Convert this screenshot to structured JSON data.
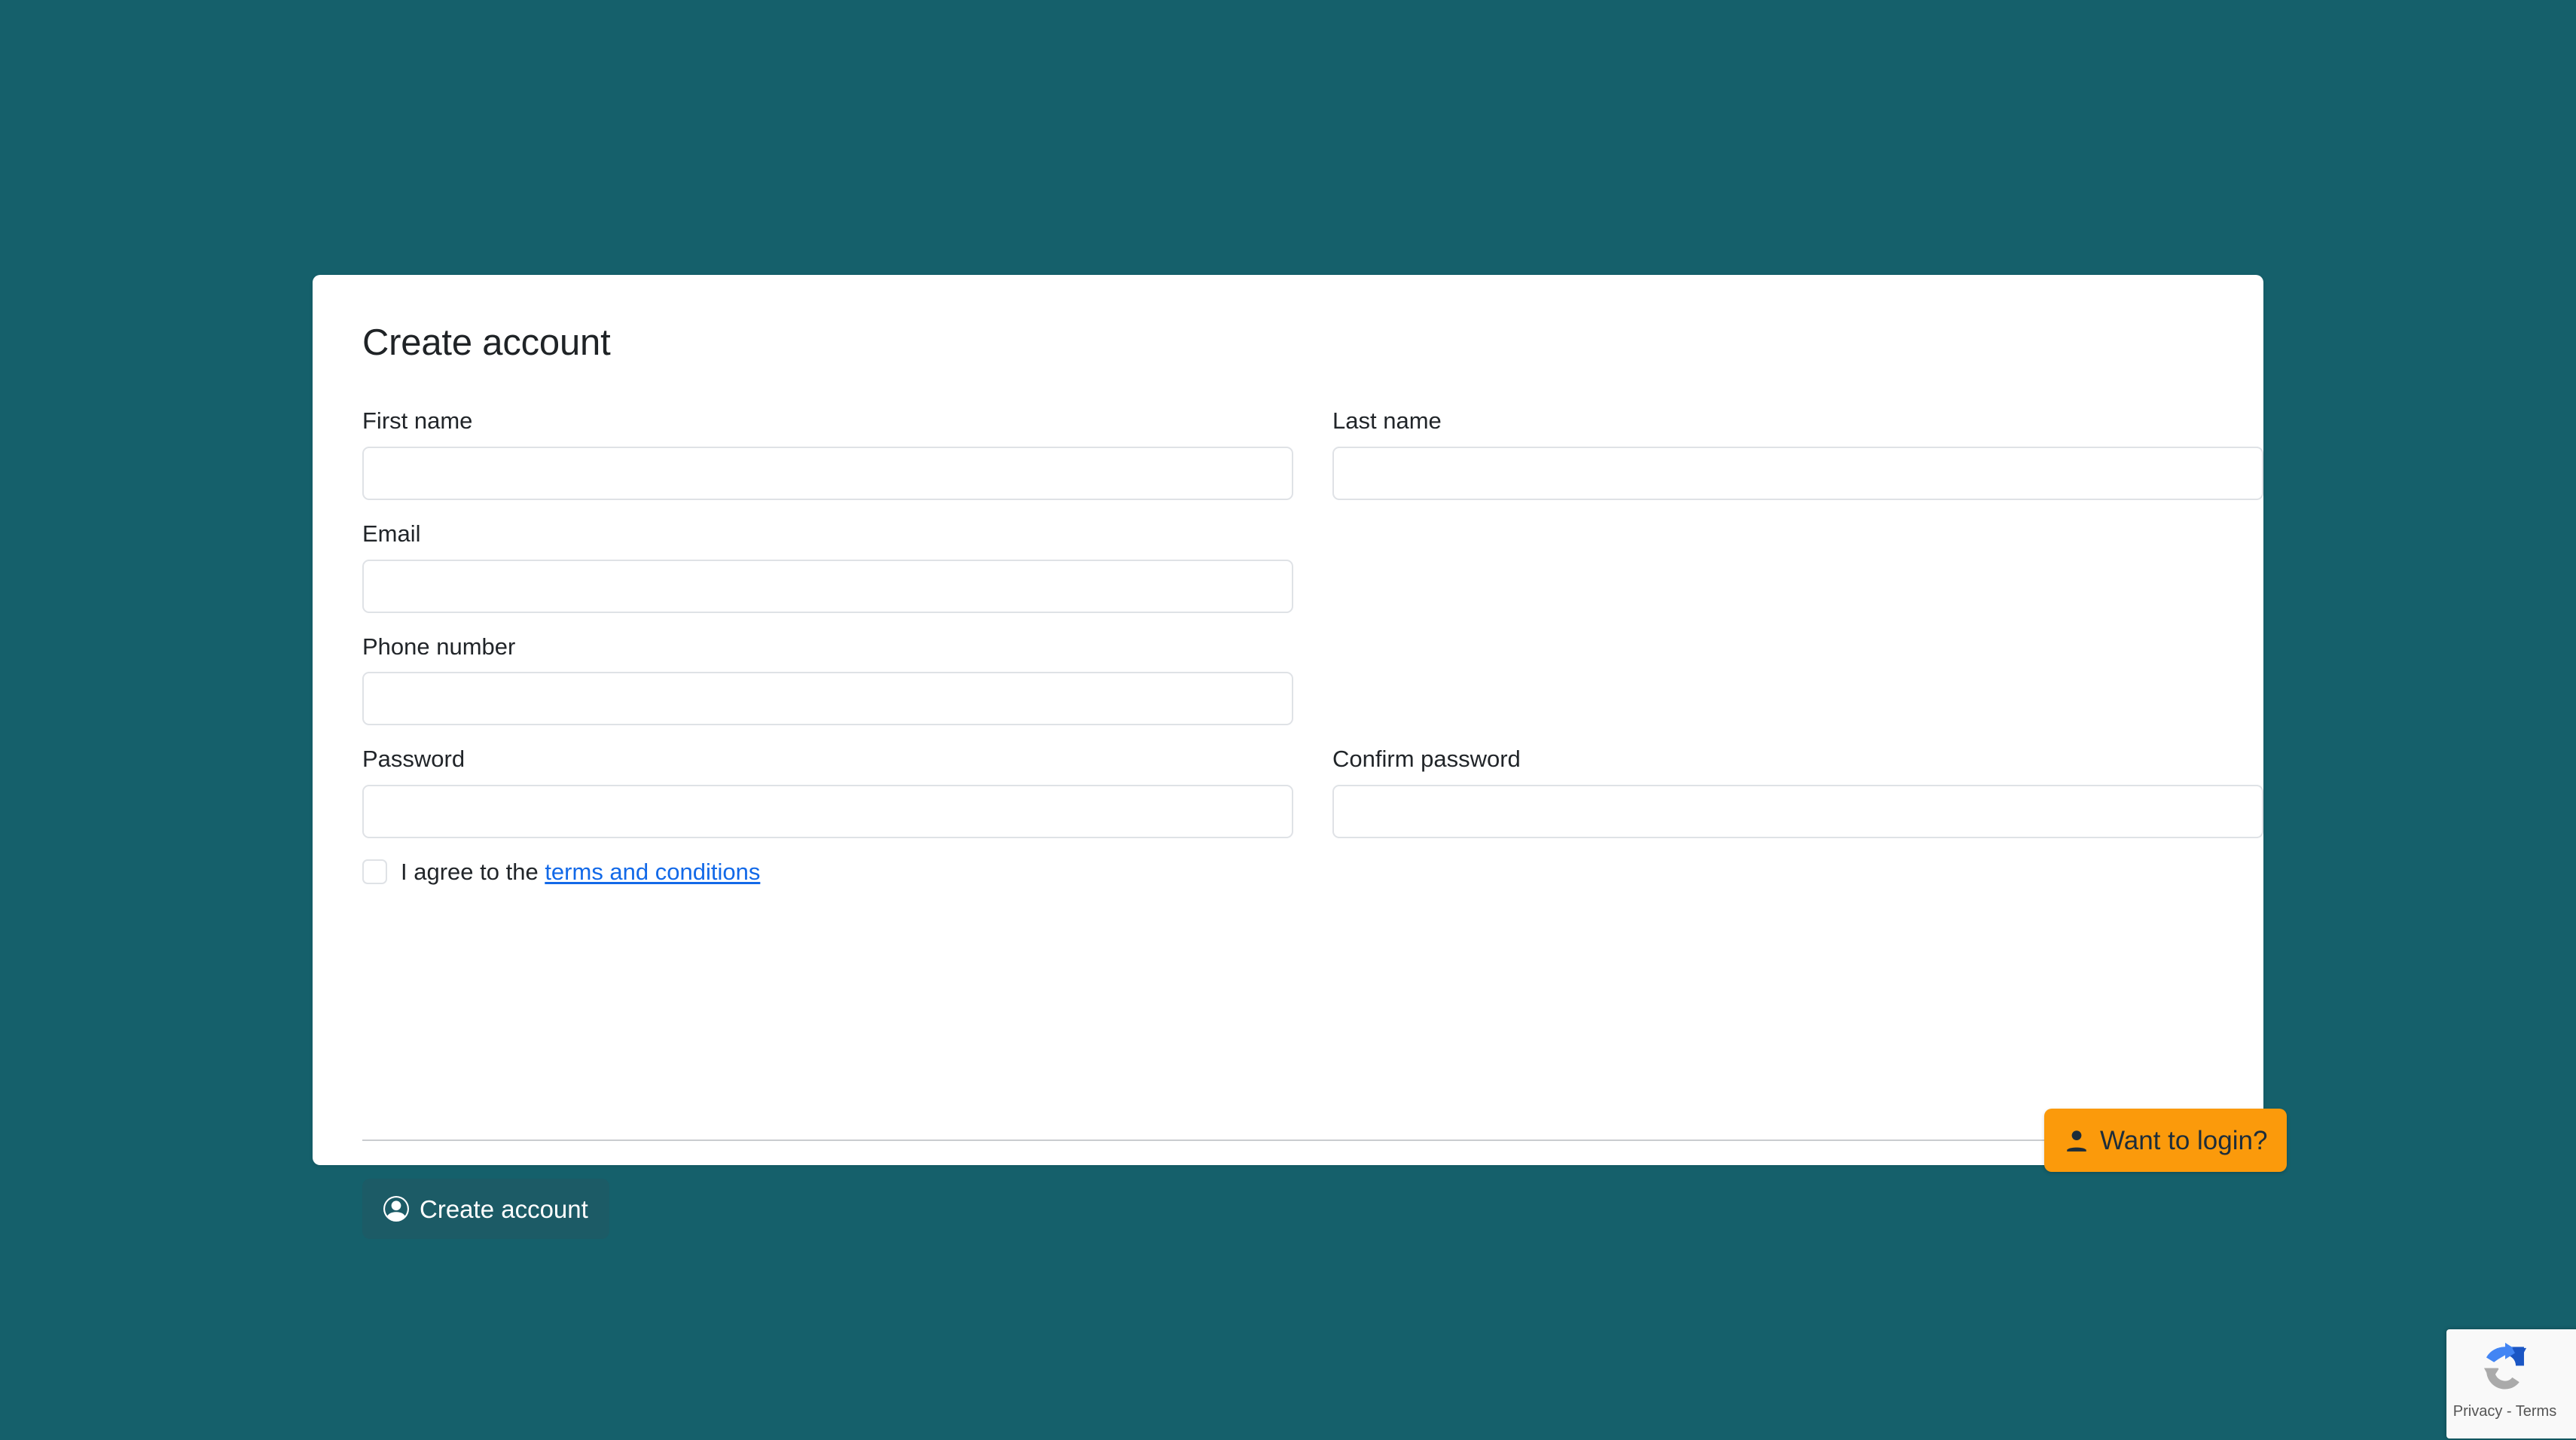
{
  "theme": {
    "background_color": "#15606b",
    "card_color": "#ffffff",
    "primary_button_color": "#1c5b66",
    "accent_button_color": "#fb9a0b",
    "link_color": "#1269e8",
    "input_border_color": "#dfe2e6",
    "divider_color": "#c9cccf"
  },
  "card": {
    "title": "Create account"
  },
  "form": {
    "rows": [
      {
        "left": {
          "label": "First name",
          "value": "",
          "placeholder": ""
        },
        "right": {
          "label": "Last name",
          "value": "",
          "placeholder": ""
        }
      },
      {
        "left": {
          "label": "Email",
          "value": "",
          "placeholder": ""
        },
        "right": null
      },
      {
        "left": {
          "label": "Phone number",
          "value": "",
          "placeholder": ""
        },
        "right": null
      },
      {
        "left": {
          "label": "Password",
          "value": "",
          "placeholder": ""
        },
        "right": {
          "label": "Confirm password",
          "value": "",
          "placeholder": ""
        }
      }
    ],
    "terms": {
      "checked": false,
      "text_before": "I agree to the ",
      "link_label": "terms and conditions"
    }
  },
  "actions": {
    "submit": {
      "label": "Create account",
      "icon": "person-circle-icon"
    },
    "login": {
      "label": "Want to login?",
      "icon": "person-solid-icon"
    }
  },
  "recaptcha": {
    "icon": "recaptcha-logo-icon",
    "text": "Privacy - Terms"
  }
}
